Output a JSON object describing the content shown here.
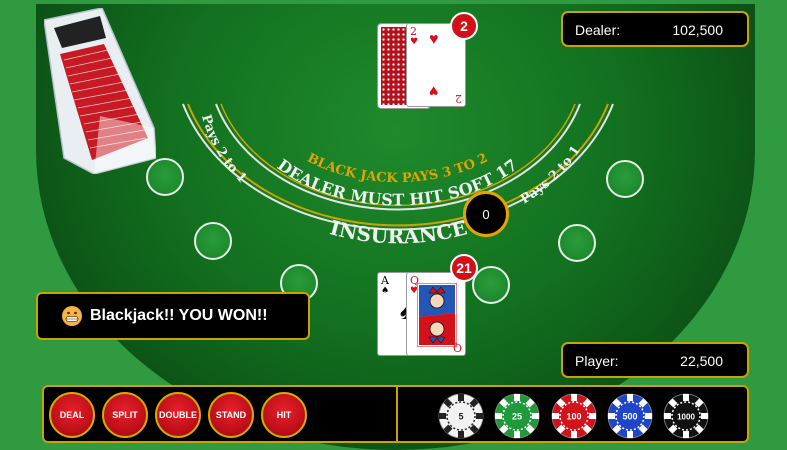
{
  "dealer": {
    "label": "Dealer:",
    "value": "102,500",
    "score": "2"
  },
  "player": {
    "label": "Player:",
    "value": "22,500",
    "score": "21"
  },
  "table": {
    "line1": "BLACK JACK PAYS 3 TO 2",
    "line2": "DEALER MUST HIT SOFT 17",
    "line3": "INSURANCE",
    "pays_left": "Pays 2 to 1",
    "pays_right": "Pays 2 to 1",
    "bet": "0"
  },
  "cards": {
    "dealer_up": {
      "rank": "2",
      "suit": "♥"
    },
    "player_1": {
      "rank": "A",
      "suit": "♠"
    },
    "player_2": {
      "rank": "Q",
      "suit": "♥"
    }
  },
  "message": "Blackjack!! YOU WON!!",
  "actions": [
    "DEAL",
    "SPLIT",
    "DOUBLE",
    "STAND",
    "HIT"
  ],
  "chips": [
    {
      "value": "5",
      "color": "#f2f2f2",
      "text_color": "#222"
    },
    {
      "value": "25",
      "color": "#1e9a3a",
      "text_color": "#fff"
    },
    {
      "value": "100",
      "color": "#d3121c",
      "text_color": "#fff"
    },
    {
      "value": "500",
      "color": "#1f45c8",
      "text_color": "#fff"
    },
    {
      "value": "1000",
      "color": "#111111",
      "text_color": "#fff"
    }
  ],
  "colors": {
    "felt": "#12701f",
    "accent": "#c8a400",
    "table_text": "#e4a400"
  }
}
